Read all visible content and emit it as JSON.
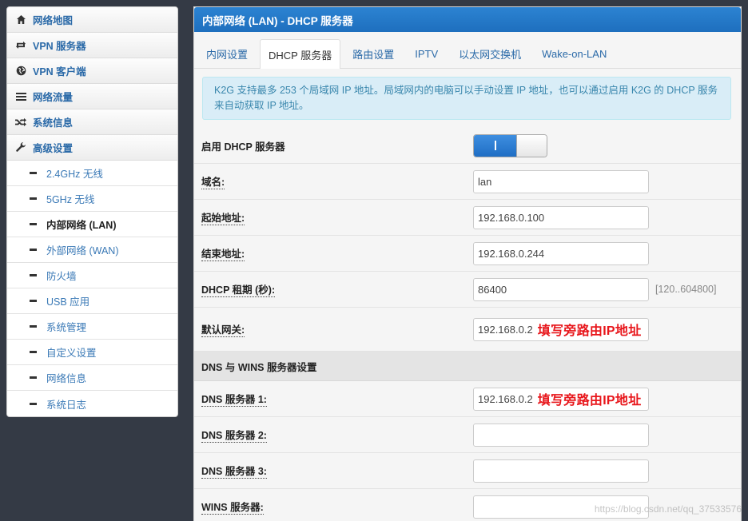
{
  "sidebar": {
    "items": [
      {
        "label": "网络地图",
        "icon": "home-icon"
      },
      {
        "label": "VPN 服务器",
        "icon": "loop-arrows-icon"
      },
      {
        "label": "VPN 客户端",
        "icon": "globe-icon"
      },
      {
        "label": "网络流量",
        "icon": "list-icon"
      },
      {
        "label": "系统信息",
        "icon": "shuffle-icon"
      },
      {
        "label": "高级设置",
        "icon": "wrench-icon"
      }
    ],
    "sub_items": [
      {
        "label": "2.4GHz 无线"
      },
      {
        "label": "5GHz 无线"
      },
      {
        "label": "内部网络 (LAN)",
        "active": true
      },
      {
        "label": "外部网络 (WAN)"
      },
      {
        "label": "防火墙"
      },
      {
        "label": "USB 应用"
      },
      {
        "label": "系统管理"
      },
      {
        "label": "自定义设置"
      },
      {
        "label": "网络信息"
      },
      {
        "label": "系统日志"
      }
    ]
  },
  "panel": {
    "title": "内部网络 (LAN) - DHCP 服务器",
    "tabs": [
      "内网设置",
      "DHCP 服务器",
      "路由设置",
      "IPTV",
      "以太网交换机",
      "Wake-on-LAN"
    ],
    "active_tab": "DHCP 服务器",
    "info": "K2G 支持最多 253 个局域网 IP 地址。局域网内的电脑可以手动设置 IP 地址，也可以通过启用 K2G 的 DHCP 服务来自动获取 IP 地址。"
  },
  "form": {
    "enable_dhcp": {
      "label": "启用 DHCP 服务器",
      "state": "on",
      "toggle_text": "I"
    },
    "domain": {
      "label": "域名:",
      "value": "lan"
    },
    "start_addr": {
      "label": "起始地址:",
      "value": "192.168.0.100"
    },
    "end_addr": {
      "label": "结束地址:",
      "value": "192.168.0.244"
    },
    "lease": {
      "label": "DHCP 租期 (秒):",
      "value": "86400",
      "hint": "[120..604800]"
    },
    "gateway": {
      "label": "默认网关:",
      "value": "192.168.0.2",
      "annotation": "填写旁路由IP地址"
    }
  },
  "dns_section": {
    "title": "DNS 与 WINS 服务器设置",
    "dns1": {
      "label": "DNS 服务器 1:",
      "value": "192.168.0.2",
      "annotation": "填写旁路由IP地址"
    },
    "dns2": {
      "label": "DNS 服务器 2:",
      "value": ""
    },
    "dns3": {
      "label": "DNS 服务器 3:",
      "value": ""
    },
    "wins": {
      "label": "WINS 服务器:",
      "value": ""
    }
  },
  "watermark": "https://blog.csdn.net/qq_37533576",
  "colors": {
    "header_blue": "#1e6fbe",
    "link_blue": "#2b6aa8",
    "annotation_red": "#e8161b",
    "info_bg": "#d9edf7"
  }
}
